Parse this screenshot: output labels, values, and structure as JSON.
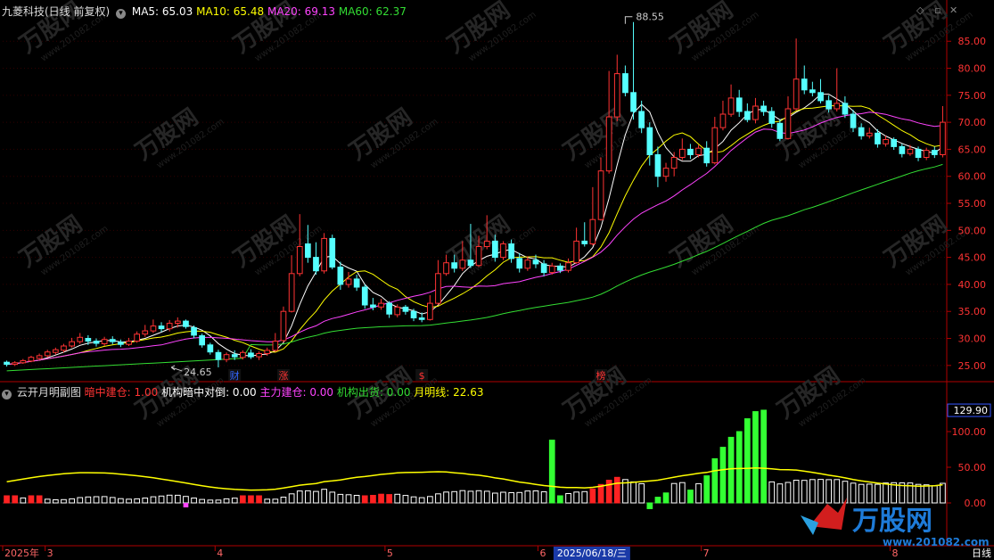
{
  "header": {
    "stock_name": "九菱科技(日线 前复权)",
    "ma": [
      {
        "label": "MA5: 65.03",
        "color": "#ffffff"
      },
      {
        "label": "MA10: 65.48",
        "color": "#ffff00"
      },
      {
        "label": "MA20: 69.13",
        "color": "#ff44ff"
      },
      {
        "label": "MA60: 62.37",
        "color": "#33dd33"
      }
    ]
  },
  "indicator_header": {
    "name": "云开月明副图",
    "items": [
      {
        "label": "暗中建仓: 1.00",
        "color": "#ff3333"
      },
      {
        "label": "机构暗中对倒: 0.00",
        "color": "#ffffff"
      },
      {
        "label": "主力建仓: 0.00",
        "color": "#ff44ff"
      },
      {
        "label": "机构出货: 0.00",
        "color": "#33dd33"
      },
      {
        "label": "月明线: 22.63",
        "color": "#ffff00"
      }
    ]
  },
  "bottom_bar": {
    "date_labels": [
      {
        "label": "2025年",
        "pos": 0.0
      },
      {
        "label": "3",
        "pos": 0.045
      },
      {
        "label": "4",
        "pos": 0.225
      },
      {
        "label": "5",
        "pos": 0.405
      },
      {
        "label": "6",
        "pos": 0.567
      },
      {
        "label": "7",
        "pos": 0.74
      },
      {
        "label": "8",
        "pos": 0.94
      }
    ],
    "cursor_date": "2025/06/18/三",
    "period": "日线"
  },
  "event_markers": [
    {
      "label": "财",
      "color": "#3366ff",
      "x": 28
    },
    {
      "label": "涨",
      "color": "#ff3333",
      "x": 34
    },
    {
      "label": "$",
      "color": "#ff3333",
      "x": 51
    },
    {
      "label": "榜",
      "color": "#ff3333",
      "x": 73
    }
  ],
  "watermark": {
    "brand": "万股网",
    "url": "www.201082.com"
  },
  "chart_data": {
    "type": "candlestick",
    "price_ylim": [
      22,
      89
    ],
    "price_ticks": [
      25,
      30,
      35,
      40,
      45,
      50,
      55,
      60,
      65,
      70,
      75,
      80,
      85
    ],
    "price_tick_labels": [
      "25.00",
      "30.00",
      "35.00",
      "40.00",
      "45.00",
      "50.00",
      "55.00",
      "60.00",
      "65.00",
      "70.00",
      "75.00",
      "80.00",
      "85.00"
    ],
    "annotations": [
      {
        "label": "88.55",
        "x": 76,
        "y": 88.55
      },
      {
        "label": "24.65",
        "x": 20,
        "y": 24.65
      }
    ],
    "series_colors": {
      "up": "#ff3333",
      "down": "#55ffff",
      "ma5": "#ffffff",
      "ma10": "#ffff00",
      "ma20": "#ff44ff",
      "ma60": "#33dd33"
    },
    "candles": [
      [
        25.6,
        25.2,
        25.9,
        24.8
      ],
      [
        25.2,
        25.5,
        25.8,
        24.9
      ],
      [
        25.5,
        25.9,
        26.2,
        25.3
      ],
      [
        25.8,
        26.5,
        26.8,
        25.6
      ],
      [
        26.3,
        26.8,
        27.2,
        26.0
      ],
      [
        26.8,
        27.5,
        27.9,
        26.5
      ],
      [
        27.4,
        27.9,
        28.3,
        27.0
      ],
      [
        27.8,
        28.6,
        29.0,
        27.4
      ],
      [
        28.6,
        29.4,
        30.1,
        28.3
      ],
      [
        29.4,
        30.2,
        31.0,
        29.0
      ],
      [
        30.0,
        29.5,
        30.6,
        28.8
      ],
      [
        29.5,
        29.1,
        30.0,
        28.5
      ],
      [
        29.0,
        29.8,
        30.3,
        28.6
      ],
      [
        29.8,
        29.4,
        30.4,
        28.9
      ],
      [
        29.3,
        28.9,
        29.8,
        28.4
      ],
      [
        28.9,
        29.5,
        30.1,
        28.6
      ],
      [
        29.5,
        30.8,
        31.3,
        29.2
      ],
      [
        30.8,
        31.4,
        32.5,
        30.3
      ],
      [
        31.4,
        32.3,
        33.5,
        31.0
      ],
      [
        32.3,
        31.8,
        33.0,
        31.2
      ],
      [
        31.8,
        32.8,
        33.4,
        31.3
      ],
      [
        32.8,
        33.2,
        33.9,
        32.0
      ],
      [
        33.2,
        32.2,
        33.5,
        31.8
      ],
      [
        32.0,
        30.6,
        32.4,
        30.0
      ],
      [
        30.5,
        28.8,
        30.9,
        28.3
      ],
      [
        28.8,
        27.5,
        29.2,
        27.0
      ],
      [
        27.4,
        26.1,
        27.9,
        24.65
      ],
      [
        26.1,
        27.0,
        27.4,
        25.6
      ],
      [
        27.0,
        26.6,
        27.8,
        26.0
      ],
      [
        26.5,
        27.4,
        27.8,
        26.1
      ],
      [
        27.3,
        26.6,
        28.0,
        26.2
      ],
      [
        26.6,
        27.2,
        27.6,
        26.0
      ],
      [
        27.2,
        27.8,
        28.3,
        26.8
      ],
      [
        27.8,
        29.5,
        31.0,
        27.5
      ],
      [
        29.6,
        35.0,
        35.9,
        29.3
      ],
      [
        35.0,
        42.0,
        45.4,
        34.8
      ],
      [
        42.0,
        47.0,
        53.0,
        41.5
      ],
      [
        47.5,
        45.0,
        51.0,
        44.0
      ],
      [
        45.0,
        42.5,
        47.8,
        41.8
      ],
      [
        42.5,
        48.5,
        49.5,
        42.0
      ],
      [
        48.5,
        43.2,
        49.2,
        42.8
      ],
      [
        43.2,
        40.0,
        44.2,
        39.0
      ],
      [
        40.0,
        41.0,
        42.3,
        39.4
      ],
      [
        41.0,
        39.5,
        41.8,
        38.8
      ],
      [
        39.5,
        36.2,
        40.0,
        35.5
      ],
      [
        36.2,
        35.8,
        37.5,
        35.2
      ],
      [
        35.8,
        36.5,
        37.3,
        35.3
      ],
      [
        36.5,
        34.5,
        36.9,
        33.8
      ],
      [
        34.4,
        35.8,
        36.3,
        33.9
      ],
      [
        35.8,
        35.0,
        36.2,
        34.4
      ],
      [
        35.0,
        33.8,
        35.5,
        33.2
      ],
      [
        33.8,
        33.5,
        34.8,
        33.0
      ],
      [
        33.5,
        36.5,
        38.0,
        33.3
      ],
      [
        36.5,
        42.0,
        44.5,
        36.2
      ],
      [
        42.0,
        44.0,
        45.5,
        41.6
      ],
      [
        44.0,
        43.0,
        45.5,
        42.2
      ],
      [
        43.0,
        44.5,
        48.0,
        42.5
      ],
      [
        44.5,
        43.5,
        51.2,
        43.0
      ],
      [
        43.5,
        47.0,
        49.0,
        43.2
      ],
      [
        47.0,
        48.0,
        52.8,
        46.5
      ],
      [
        48.0,
        45.0,
        49.2,
        44.2
      ],
      [
        45.0,
        47.5,
        48.0,
        44.5
      ],
      [
        47.5,
        44.8,
        48.3,
        44.0
      ],
      [
        44.8,
        43.0,
        45.8,
        42.2
      ],
      [
        43.0,
        44.5,
        45.2,
        42.5
      ],
      [
        44.5,
        43.8,
        45.5,
        43.0
      ],
      [
        43.8,
        42.2,
        44.5,
        41.5
      ],
      [
        42.2,
        43.4,
        44.0,
        41.8
      ],
      [
        43.4,
        42.6,
        43.9,
        42.1
      ],
      [
        42.6,
        44.0,
        44.8,
        42.2
      ],
      [
        44.0,
        48.0,
        50.5,
        43.8
      ],
      [
        48.0,
        47.5,
        51.5,
        47.0
      ],
      [
        47.5,
        52.0,
        58.0,
        47.2
      ],
      [
        52.0,
        61.0,
        63.5,
        51.8
      ],
      [
        61.0,
        71.0,
        79.5,
        60.5
      ],
      [
        71.0,
        79.0,
        82.5,
        70.2
      ],
      [
        79.0,
        75.5,
        80.5,
        74.8
      ],
      [
        75.5,
        72.0,
        88.55,
        70.5
      ],
      [
        72.0,
        69.0,
        74.0,
        68.0
      ],
      [
        69.0,
        64.0,
        70.0,
        62.0
      ],
      [
        64.0,
        60.0,
        65.5,
        58.0
      ],
      [
        60.0,
        61.5,
        62.5,
        59.0
      ],
      [
        61.5,
        63.5,
        64.5,
        60.0
      ],
      [
        63.5,
        65.0,
        67.0,
        63.0
      ],
      [
        65.0,
        64.0,
        66.0,
        63.2
      ],
      [
        64.0,
        65.2,
        65.8,
        63.5
      ],
      [
        65.2,
        62.5,
        66.5,
        61.8
      ],
      [
        62.5,
        69.0,
        71.0,
        62.2
      ],
      [
        69.0,
        71.5,
        74.0,
        68.5
      ],
      [
        71.5,
        74.5,
        77.0,
        71.0
      ],
      [
        74.5,
        72.0,
        76.0,
        71.0
      ],
      [
        72.0,
        70.5,
        73.5,
        70.0
      ],
      [
        70.5,
        73.0,
        74.5,
        69.8
      ],
      [
        73.0,
        72.0,
        74.0,
        71.2
      ],
      [
        72.0,
        69.8,
        72.8,
        69.0
      ],
      [
        69.8,
        67.0,
        70.5,
        66.5
      ],
      [
        67.0,
        72.5,
        74.8,
        66.8
      ],
      [
        72.5,
        78.0,
        85.5,
        72.2
      ],
      [
        78.0,
        76.0,
        80.5,
        75.2
      ],
      [
        76.0,
        75.5,
        77.5,
        74.8
      ],
      [
        75.5,
        74.0,
        78.0,
        73.5
      ],
      [
        74.0,
        72.5,
        75.0,
        71.8
      ],
      [
        72.5,
        73.5,
        80.0,
        72.0
      ],
      [
        73.5,
        71.5,
        74.8,
        70.8
      ],
      [
        71.5,
        69.0,
        72.3,
        68.2
      ],
      [
        69.0,
        67.5,
        69.8,
        66.8
      ],
      [
        67.5,
        68.0,
        69.0,
        67.0
      ],
      [
        68.0,
        66.0,
        68.7,
        65.3
      ],
      [
        66.0,
        66.8,
        67.5,
        65.5
      ],
      [
        66.8,
        65.5,
        67.2,
        64.9
      ],
      [
        65.5,
        64.2,
        66.0,
        63.5
      ],
      [
        64.2,
        65.0,
        65.8,
        63.8
      ],
      [
        65.0,
        63.5,
        65.5,
        62.8
      ],
      [
        63.5,
        64.8,
        65.3,
        63.0
      ],
      [
        64.8,
        64.0,
        65.5,
        63.4
      ],
      [
        64.0,
        70.0,
        73.0,
        63.5
      ]
    ],
    "indicator_ylim": [
      -10,
      145
    ],
    "indicator_ticks": [
      0,
      50,
      100
    ],
    "indicator_tick_labels": [
      "0.00",
      "50.00",
      "100.00"
    ],
    "indicator_current_label": "129.90",
    "indicator_current_value": 129.9
  }
}
